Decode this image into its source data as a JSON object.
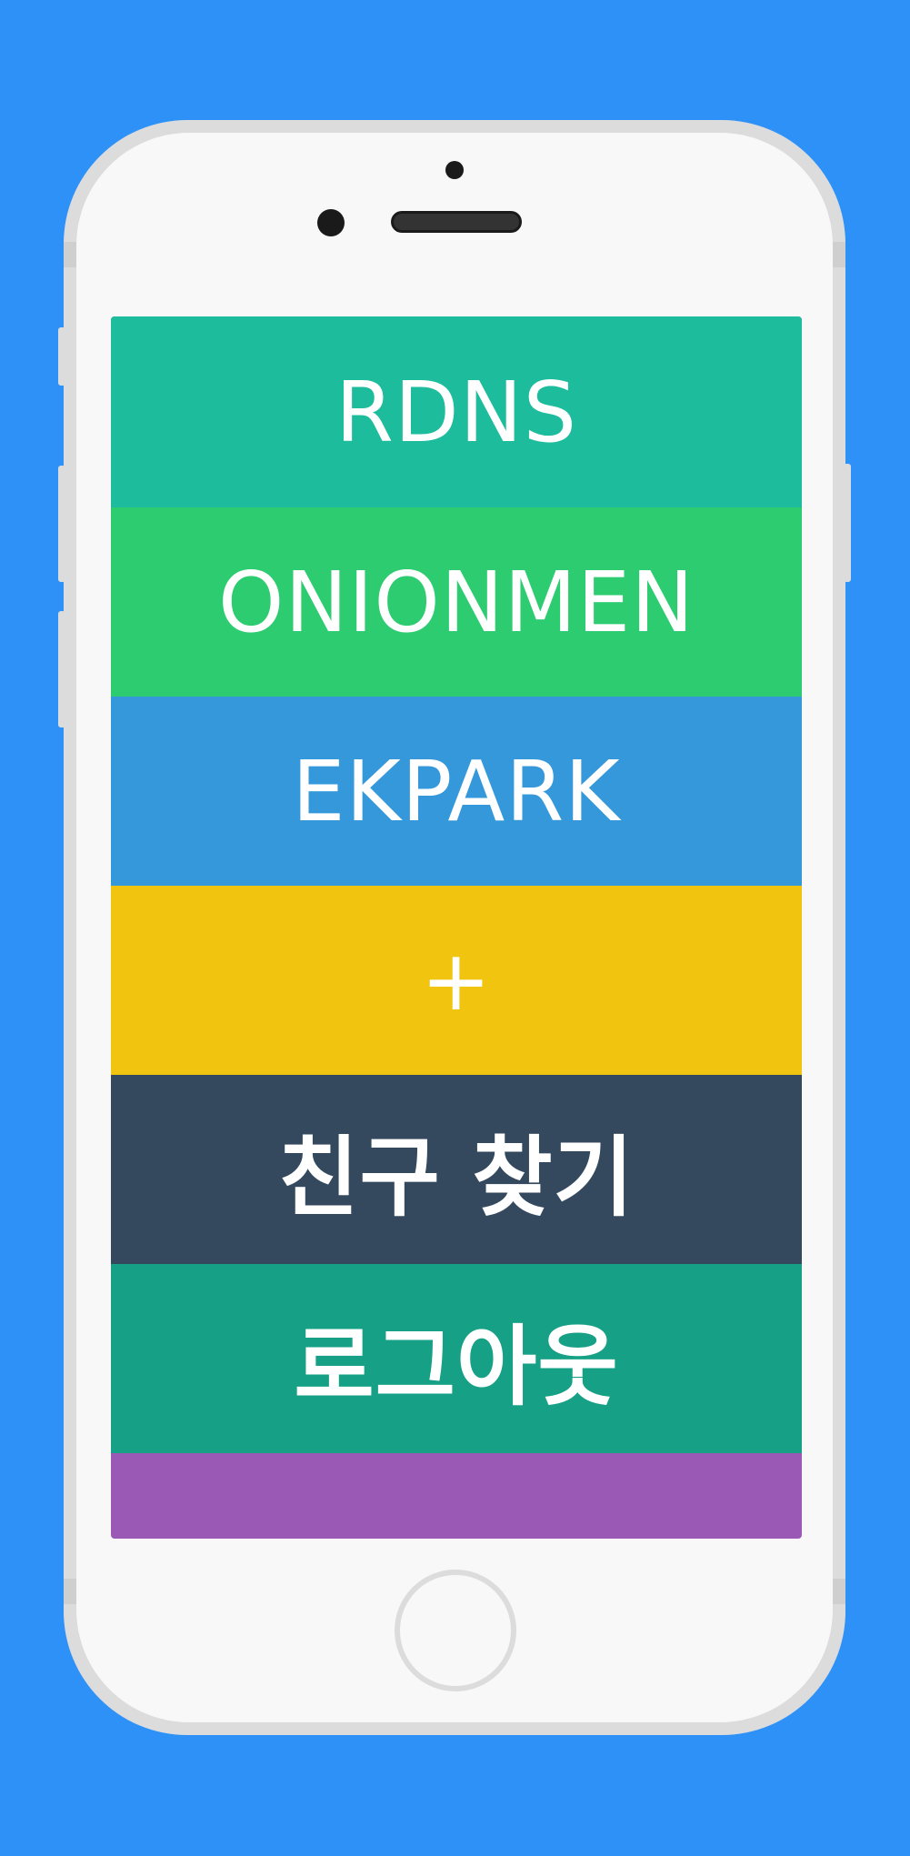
{
  "menu": {
    "items": [
      {
        "label": "RDNS",
        "color": "#1dbc9c"
      },
      {
        "label": "ONIONMEN",
        "color": "#2ecc71"
      },
      {
        "label": "EKPARK",
        "color": "#3498db"
      },
      {
        "label": "+",
        "color": "#f1c40f"
      },
      {
        "label": "친구 찾기",
        "color": "#34495e"
      },
      {
        "label": "로그아웃",
        "color": "#16a085"
      }
    ],
    "footer_color": "#9b59b6"
  },
  "colors": {
    "background": "#2d91f7",
    "phone_frame": "#dcdcdc",
    "phone_body": "#f8f8f8"
  }
}
